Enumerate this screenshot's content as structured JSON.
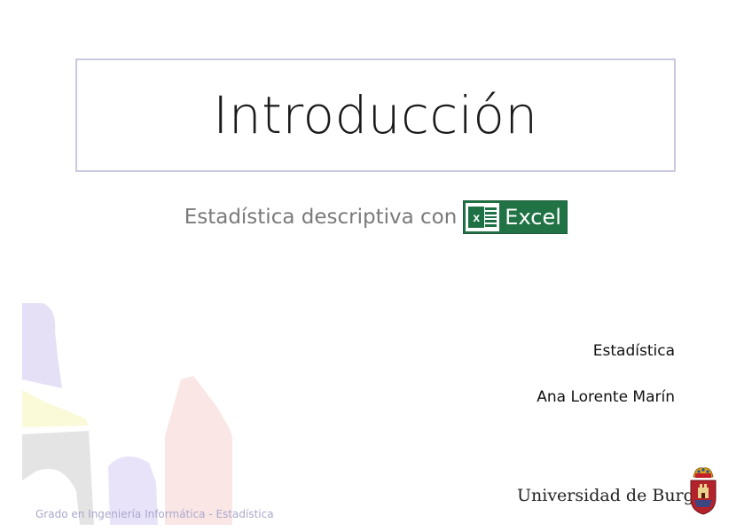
{
  "slide": {
    "title": "Introducción",
    "subtitle": "Estadística descriptiva con",
    "logo": {
      "word": "Excel",
      "badge_letter": "x",
      "color": "#217346"
    },
    "subject": "Estadística",
    "author": "Ana Lorente Marín",
    "university": "Universidad de Burgos",
    "footer": "Grado en Ingeniería Informática  - Estadística"
  }
}
